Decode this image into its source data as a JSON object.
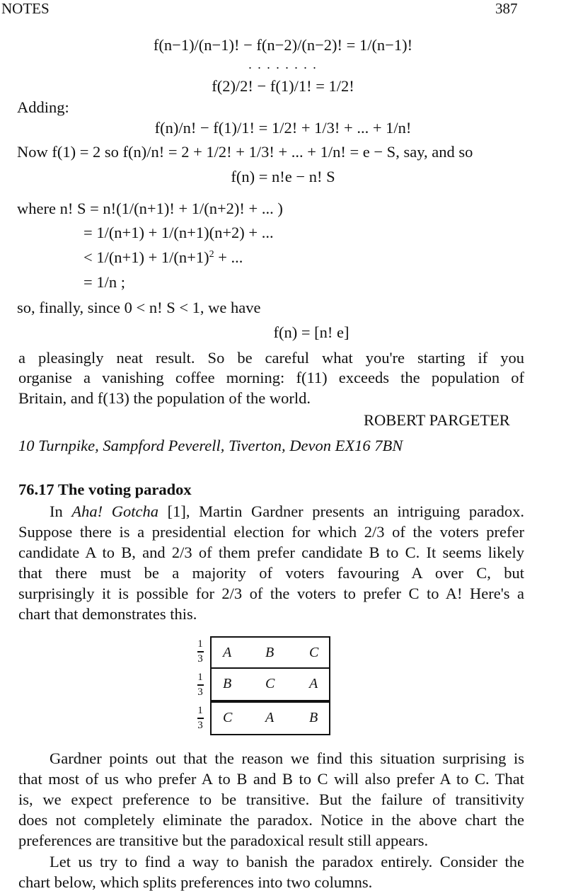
{
  "header": {
    "section": "NOTES",
    "page_number": "387"
  },
  "equations_top": {
    "line1": "f(n−1)/(n−1)! − f(n−2)/(n−2)! = 1/(n−1)!",
    "dots": ". . . . . . . .",
    "line2": "f(2)/2! − f(1)/1! = 1/2!"
  },
  "adding_label": "Adding:",
  "sum_equation": "f(n)/n! − f(1)/1! = 1/2! + 1/3! + ... + 1/n!",
  "now_line": "Now f(1) = 2 so f(n)/n! = 2 + 1/2! + 1/3! + ... + 1/n! = e − S, say, and so",
  "fn_equation": "f(n) = n!e − n! S",
  "where_lines": [
    "where n! S = n!(1/(n+1)! + 1/(n+2)! + ... )",
    "= 1/(n+1) + 1/(n+1)(n+2) + ...",
    "< 1/(n+1) + 1/(n+1)",
    "= 1/n ;"
  ],
  "where_sup": "2",
  "where_tail": " + ...",
  "finally_line": "so, finally, since 0 < n! S < 1, we have",
  "final_equation": "f(n) = [n! e]",
  "closing_paragraph": [
    "a pleasingly neat result. So be careful what you're starting if you",
    "organise a vanishing coffee morning: f(11) exceeds the population of",
    "Britain, and f(13) the population of the world."
  ],
  "author": "ROBERT PARGETER",
  "address": "10 Turnpike, Sampford Peverell, Tiverton, Devon EX16 7BN",
  "section_title": "76.17 The voting paradox",
  "para1": {
    "intro": "In ",
    "book": "Aha! Gotcha",
    "rest_line1": " [1], Martin Gardner presents an intriguing paradox.",
    "lines": [
      "Suppose there is a presidential election for which 2/3 of the voters prefer",
      "candidate A to B, and 2/3 of them prefer candidate B to C. It seems likely",
      "that there must be a majority of voters favouring A over C, but",
      "surprisingly it is possible for 2/3 of the voters to prefer C to A!  Here's a",
      "chart that demonstrates this."
    ]
  },
  "preference_table": {
    "row_labels": [
      {
        "num": "1",
        "den": "3"
      },
      {
        "num": "1",
        "den": "3"
      },
      {
        "num": "1",
        "den": "3"
      }
    ],
    "rows": [
      [
        "A",
        "B",
        "C"
      ],
      [
        "B",
        "C",
        "A"
      ],
      [
        "C",
        "A",
        "B"
      ]
    ]
  },
  "para2": [
    "Gardner points out that the reason we find this situation surprising is",
    "that most of us who prefer A to B and B to C will also prefer A to C. That",
    "is, we expect preference to be transitive. But the failure of transitivity",
    "does not completely eliminate the paradox. Notice in the above chart the",
    "preferences are transitive but the paradoxical result still appears."
  ],
  "para3": [
    "Let us try to find a way to banish the paradox entirely. Consider the",
    "chart below, which splits preferences into two columns."
  ]
}
